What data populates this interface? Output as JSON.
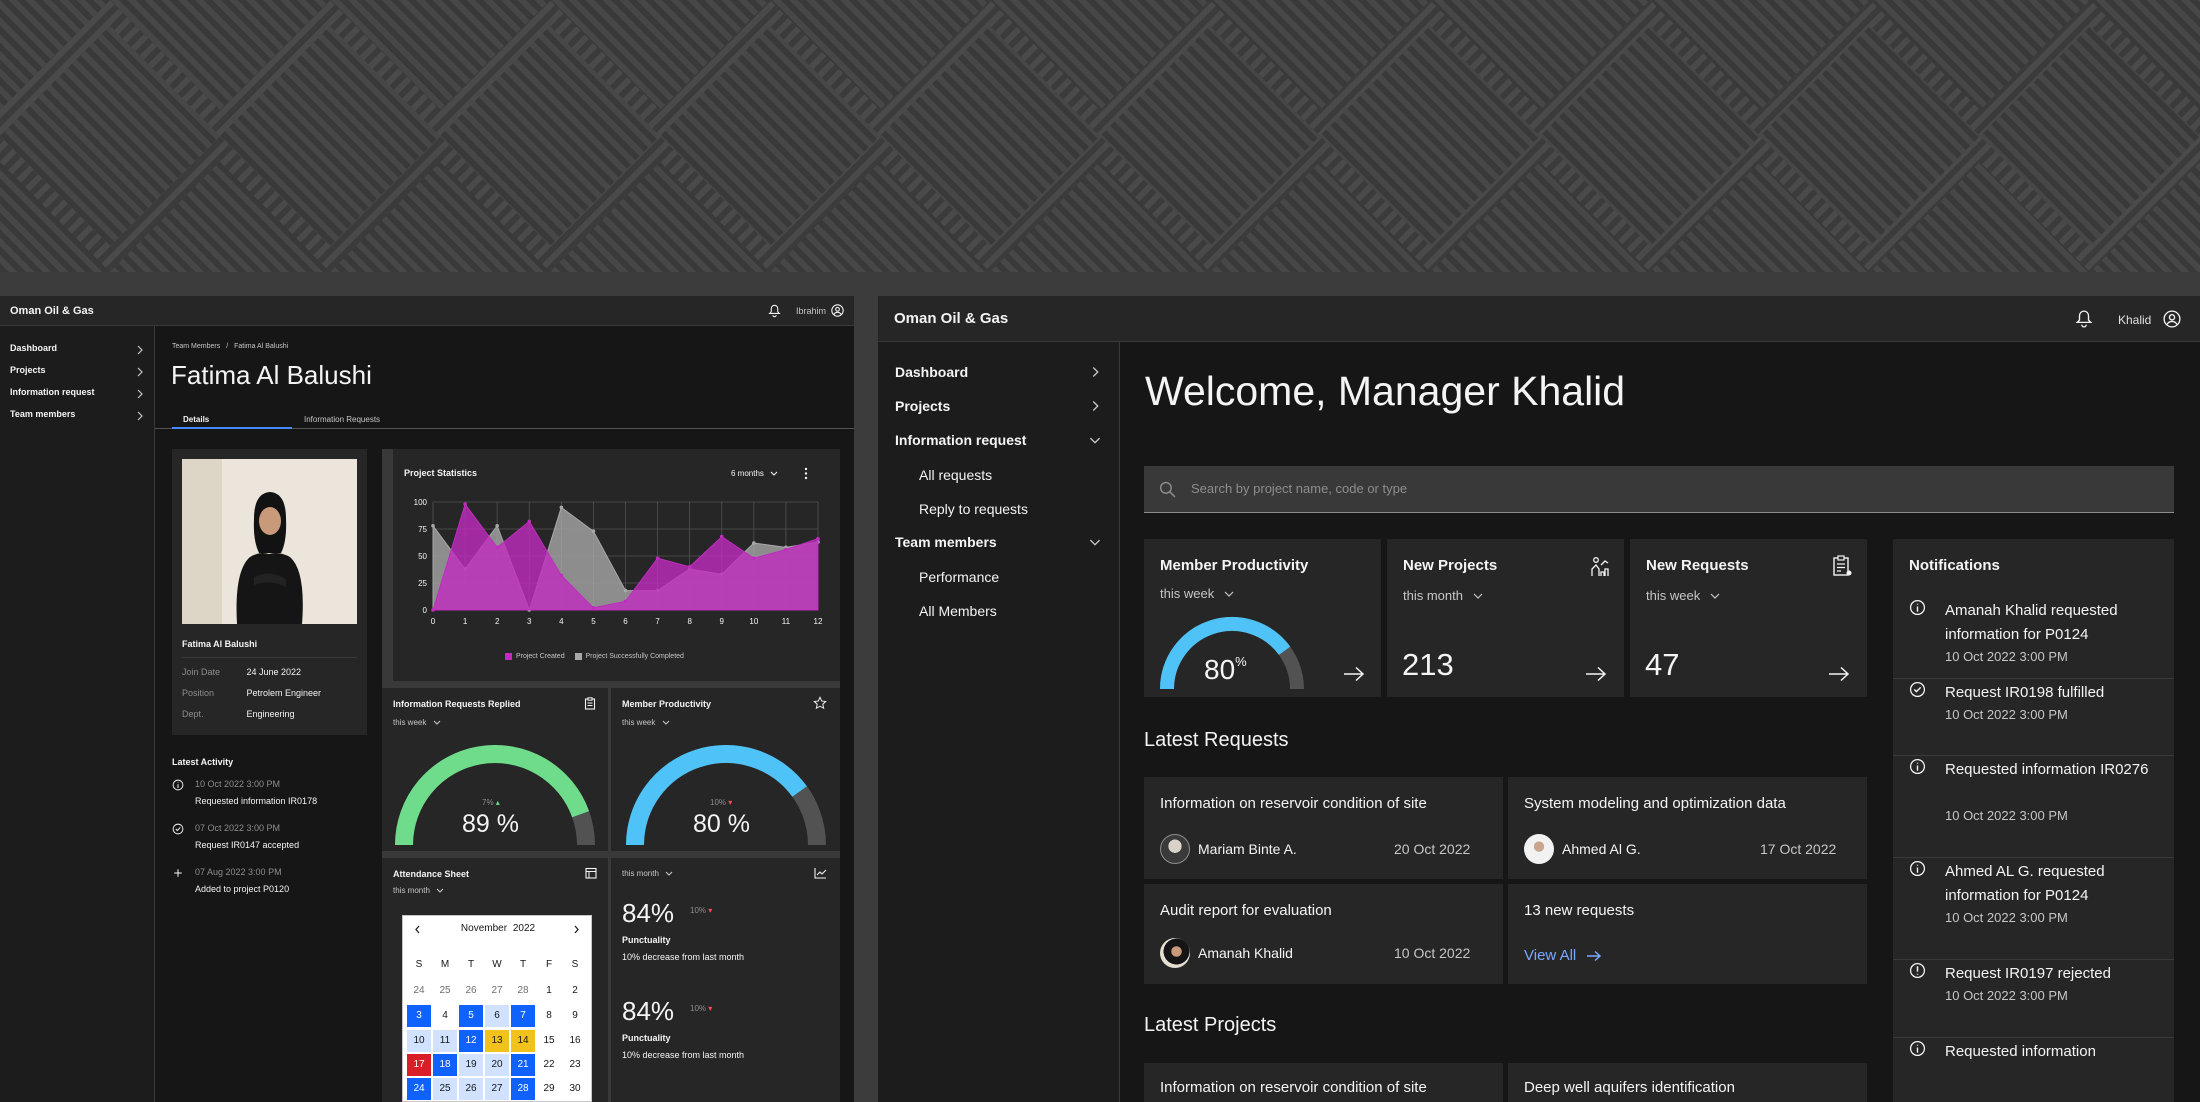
{
  "left": {
    "app_title": "Oman Oil & Gas",
    "user": "Ibrahim",
    "nav": [
      {
        "label": "Dashboard"
      },
      {
        "label": "Projects"
      },
      {
        "label": "Information request"
      },
      {
        "label": "Team members"
      }
    ],
    "breadcrumb": {
      "root": "Team Members",
      "sep": "/",
      "current": "Fatima Al Balushi"
    },
    "page_title": "Fatima Al Balushi",
    "tabs": [
      {
        "label": "Details",
        "active": true
      },
      {
        "label": "Information Requests"
      }
    ],
    "profile": {
      "name": "Fatima Al Balushi",
      "fields": [
        {
          "label": "Join Date",
          "value": "24 June 2022"
        },
        {
          "label": "Position",
          "value": "Petrolem Engineer"
        },
        {
          "label": "Dept.",
          "value": "Engineering"
        }
      ]
    },
    "activity": {
      "title": "Latest Activity",
      "items": [
        {
          "icon": "info-icon",
          "date": "10 Oct 2022 3:00 PM",
          "text": "Requested information IR0178"
        },
        {
          "icon": "check-circle-icon",
          "date": "07 Oct 2022 3:00 PM",
          "text": "Request IR0147 accepted"
        },
        {
          "icon": "add-icon",
          "date": "07 Aug 2022 3:00 PM",
          "text": "Added to project P0120"
        }
      ]
    },
    "project_stats": {
      "title": "Project Statistics",
      "range": "6 months",
      "legend_created": "Project Created",
      "legend_completed": "Project Successfully Completed"
    },
    "info_replied": {
      "title": "Information Requests Replied",
      "period": "this week",
      "delta": "7%",
      "value": "89 %"
    },
    "member_prod_small": {
      "title": "Member Productivity",
      "period": "this week",
      "delta": "10%",
      "value": "80 %"
    },
    "attendance": {
      "title": "Attendance Sheet",
      "period": "this month",
      "month": "November",
      "year": "2022",
      "weekdays": [
        "S",
        "M",
        "T",
        "W",
        "T",
        "F",
        "S"
      ]
    },
    "punctuality": {
      "period": "this month",
      "items": [
        {
          "value": "84%",
          "delta": "10%",
          "label": "Punctuality",
          "note": "10% decrease from last month"
        },
        {
          "value": "84%",
          "delta": "10%",
          "label": "Punctuality",
          "note": "10% decrease from last month"
        }
      ]
    }
  },
  "right": {
    "app_title": "Oman Oil & Gas",
    "user": "Khalid",
    "nav": {
      "dashboard": "Dashboard",
      "projects": "Projects",
      "info_request": "Information request",
      "all_requests": "All requests",
      "reply_requests": "Reply to requests",
      "team_members": "Team members",
      "performance": "Performance",
      "all_members": "All Members"
    },
    "welcome": "Welcome, Manager Khalid",
    "search_placeholder": "Search by project name, code or type",
    "kpis": [
      {
        "title": "Member Productivity",
        "period": "this week",
        "value": "80",
        "unit": "%",
        "gauge": 0.8
      },
      {
        "title": "New Projects",
        "period": "this month",
        "value": "213"
      },
      {
        "title": "New Requests",
        "period": "this week",
        "value": "47"
      }
    ],
    "latest_requests_title": "Latest Requests",
    "requests": [
      {
        "title": "Information on reservoir condition of site",
        "person": "Mariam Binte A.",
        "date": "20 Oct 2022"
      },
      {
        "title": "System modeling and optimization data",
        "person": "Ahmed Al G.",
        "date": "17 Oct 2022"
      },
      {
        "title": "Audit report for evaluation",
        "person": "Amanah Khalid",
        "date": "10 Oct 2022"
      }
    ],
    "new_requests": {
      "title": "13 new requests",
      "link": "View All"
    },
    "latest_projects_title": "Latest Projects",
    "projects": [
      {
        "title": "Information on reservoir condition of site"
      },
      {
        "title": "Deep well aquifers identification"
      }
    ],
    "notifications": {
      "title": "Notifications",
      "items": [
        {
          "icon": "info-icon",
          "text": "Amanah Khalid requested information for P0124",
          "time": "10 Oct 2022 3:00 PM"
        },
        {
          "icon": "check-circle-icon",
          "text": "Request IR0198 fulfilled",
          "time": "10 Oct 2022 3:00 PM"
        },
        {
          "icon": "info-icon",
          "text": "Requested information IR0276",
          "time": "10 Oct 2022 3:00 PM"
        },
        {
          "icon": "info-icon",
          "text": "Ahmed AL G. requested information for P0124",
          "time": "10 Oct 2022 3:00 PM"
        },
        {
          "icon": "warning-icon",
          "text": "Request IR0197 rejected",
          "time": "10 Oct 2022 3:00 PM"
        },
        {
          "icon": "info-icon",
          "text": "Requested information",
          "time": ""
        }
      ]
    }
  },
  "chart_data": {
    "type": "area",
    "title": "Project Statistics",
    "x": [
      0,
      1,
      2,
      3,
      4,
      5,
      6,
      7,
      8,
      9,
      10,
      11,
      12
    ],
    "ylim": [
      0,
      100
    ],
    "yticks": [
      0,
      25,
      50,
      75,
      100
    ],
    "series": [
      {
        "name": "Project Created",
        "color": "#c02cc0",
        "values": [
          0,
          98,
          58,
          82,
          32,
          2,
          8,
          48,
          40,
          68,
          48,
          56,
          66
        ]
      },
      {
        "name": "Project Successfully Completed",
        "color": "#a8a8a8",
        "values": [
          78,
          38,
          78,
          0,
          95,
          73,
          18,
          18,
          38,
          33,
          62,
          58,
          63
        ]
      }
    ]
  }
}
